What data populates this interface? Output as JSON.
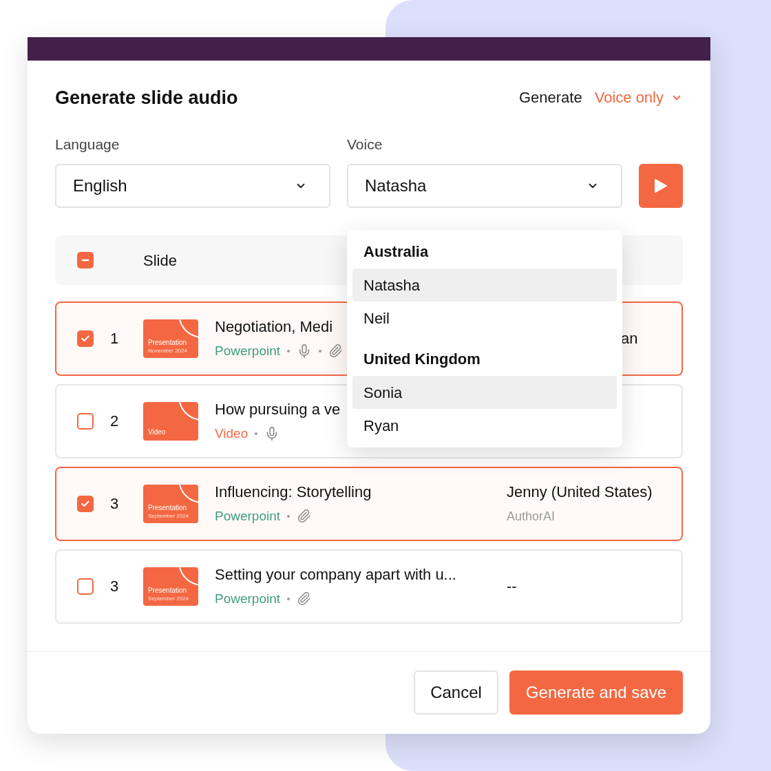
{
  "dialog": {
    "title": "Generate slide audio",
    "generate_label": "Generate",
    "generate_mode": "Voice only"
  },
  "fields": [
    {
      "label": "Language",
      "value": "English"
    },
    {
      "label": "Voice",
      "value": "Natasha",
      "menu": {
        "groups": [
          {
            "label": "Australia",
            "options": [
              {
                "label": "Natasha",
                "highlighted": true
              },
              {
                "label": "Neil",
                "highlighted": false
              }
            ]
          },
          {
            "label": "United Kingdom",
            "options": [
              {
                "label": "Sonia",
                "highlighted": true
              },
              {
                "label": "Ryan",
                "highlighted": false
              }
            ]
          }
        ]
      }
    }
  ],
  "table": {
    "header": {
      "label": "Slide",
      "indeterminate": true
    },
    "rows": [
      {
        "checked": true,
        "number": "1",
        "thumbnail": {
          "label": "Presentation",
          "date": "November 2024"
        },
        "title": "Negotiation, Medi",
        "type": {
          "kind": "powerpoint",
          "label": "Powerpoint"
        },
        "audio": true,
        "attachment": true,
        "voice": {
          "name": "an",
          "partly_covered": true
        }
      },
      {
        "checked": false,
        "number": "2",
        "thumbnail": {
          "label": "Video"
        },
        "title": "How pursuing a ve",
        "type": {
          "kind": "video",
          "label": "Video"
        },
        "audio": true,
        "attachment": false
      },
      {
        "checked": true,
        "number": "3",
        "thumbnail": {
          "label": "Presentation",
          "date": "September 2024"
        },
        "title": "Influencing: Storytelling",
        "type": {
          "kind": "powerpoint",
          "label": "Powerpoint"
        },
        "audio": false,
        "attachment": true,
        "voice": {
          "name": "Jenny (United States)",
          "source": "AuthorAI"
        }
      },
      {
        "checked": false,
        "number": "3",
        "thumbnail": {
          "label": "Presentation",
          "date": "September 2024"
        },
        "title": "Setting your company apart with u...",
        "type": {
          "kind": "powerpoint",
          "label": "Powerpoint"
        },
        "audio": false,
        "attachment": true,
        "voice": {
          "name": "--"
        }
      }
    ]
  },
  "buttons": [
    {
      "label": "Cancel",
      "kind": "secondary"
    },
    {
      "label": "Generate and save",
      "kind": "primary"
    }
  ]
}
